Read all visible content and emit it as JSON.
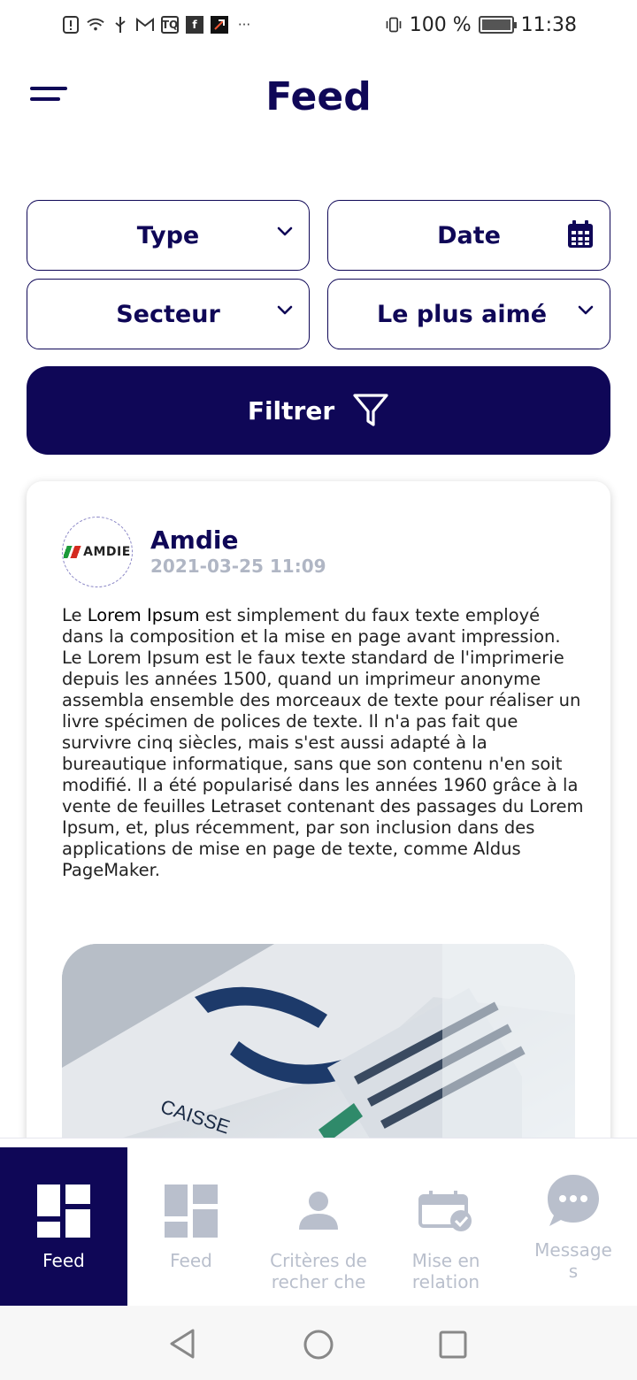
{
  "status_bar": {
    "notification_icons": [
      "alert-icon",
      "wifi-icon",
      "usb-icon",
      "gmail-icon",
      "tq-icon",
      "facebook-icon",
      "app-icon",
      "more-icon"
    ],
    "battery": "100 %",
    "time": "11:38"
  },
  "header": {
    "title": "Feed"
  },
  "filters": {
    "type": "Type",
    "date": "Date",
    "sector": "Secteur",
    "most_liked": "Le plus aimé",
    "submit": "Filtrer"
  },
  "post": {
    "author": "Amdie",
    "logo_text": "AMDIE",
    "timestamp": "2021-03-25 11:09",
    "text_prefix": "Le ",
    "text_highlight": "Lorem Ipsum",
    "text_body": " est simplement du faux texte employé dans la composition et la mise en page avant impression. Le Lorem Ipsum est le faux texte standard de l'imprimerie depuis les années 1500, quand un imprimeur anonyme assembla ensemble des morceaux de texte pour réaliser un livre spécimen de polices de texte. Il n'a pas fait que survivre cinq siècles, mais s'est aussi adapté à la bureautique informatique, sans que son contenu n'en soit modifié. Il a été popularisé dans les années 1960 grâce à la vente de feuilles Letraset contenant des passages du Lorem Ipsum, et, plus récemment, par son inclusion dans des applications de mise en page de texte, comme Aldus PageMaker."
  },
  "bottom_nav": [
    {
      "label": "Feed",
      "active": true
    },
    {
      "label": "Feed",
      "active": false
    },
    {
      "label": "Critères de recher che",
      "active": false
    },
    {
      "label": "Mise en relation",
      "active": false
    },
    {
      "label": "Message s",
      "active": false
    }
  ],
  "colors": {
    "primary": "#0f0757",
    "muted": "#b9bfcc"
  }
}
